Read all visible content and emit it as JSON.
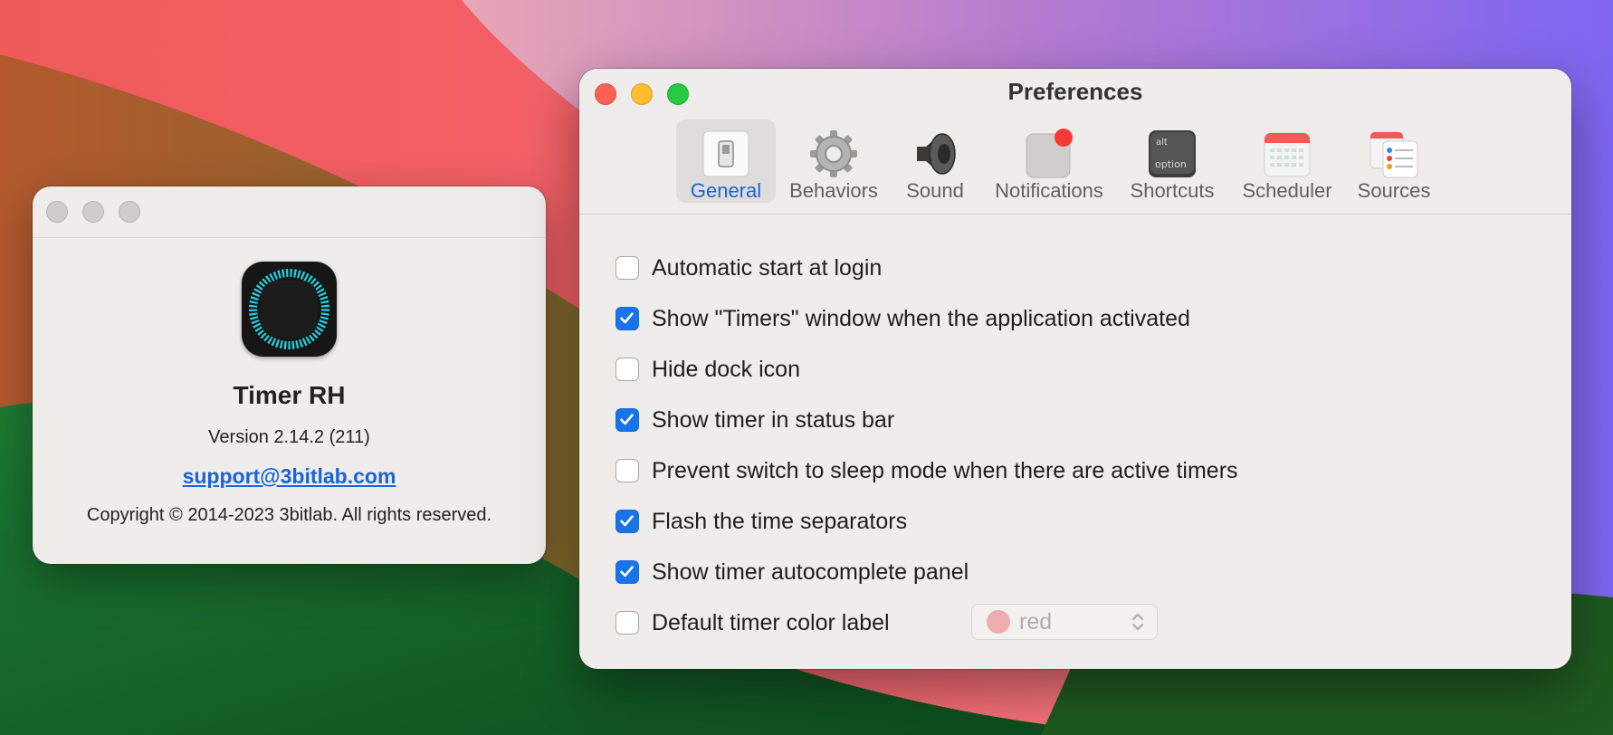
{
  "about_window": {
    "app_name": "Timer RH",
    "version": "Version 2.14.2 (211)",
    "email": "support@3bitlab.com",
    "copyright": "Copyright © 2014-2023 3bitlab. All rights reserved."
  },
  "preferences_window": {
    "title": "Preferences",
    "toolbar": [
      {
        "label": "General",
        "icon": "switch-icon",
        "selected": true
      },
      {
        "label": "Behaviors",
        "icon": "gear-icon",
        "selected": false
      },
      {
        "label": "Sound",
        "icon": "speaker-icon",
        "selected": false
      },
      {
        "label": "Notifications",
        "icon": "notification-badge-icon",
        "selected": false
      },
      {
        "label": "Shortcuts",
        "icon": "option-key-icon",
        "selected": false
      },
      {
        "label": "Scheduler",
        "icon": "calendar-icon",
        "selected": false
      },
      {
        "label": "Sources",
        "icon": "lists-icon",
        "selected": false
      }
    ],
    "settings": [
      {
        "label": "Automatic start at login",
        "checked": false
      },
      {
        "label": "Show \"Timers\" window when the application activated",
        "checked": true
      },
      {
        "label": "Hide dock icon",
        "checked": false
      },
      {
        "label": "Show timer in status bar",
        "checked": true
      },
      {
        "label": "Prevent switch to sleep mode when there are active timers",
        "checked": false
      },
      {
        "label": "Flash the time separators",
        "checked": true
      },
      {
        "label": "Show timer autocomplete panel",
        "checked": true
      },
      {
        "label": "Default timer color label",
        "checked": false
      }
    ],
    "color_popup": {
      "value": "red",
      "swatch_color": "#f0a6a7",
      "enabled": false
    },
    "key_labels": {
      "top": "alt",
      "bottom": "option"
    }
  },
  "colors": {
    "accent": "#1a73ea",
    "close": "#fe5f57",
    "minimize": "#febc2e",
    "zoom": "#28c840",
    "app_icon_ring": "#1fd3e0"
  }
}
